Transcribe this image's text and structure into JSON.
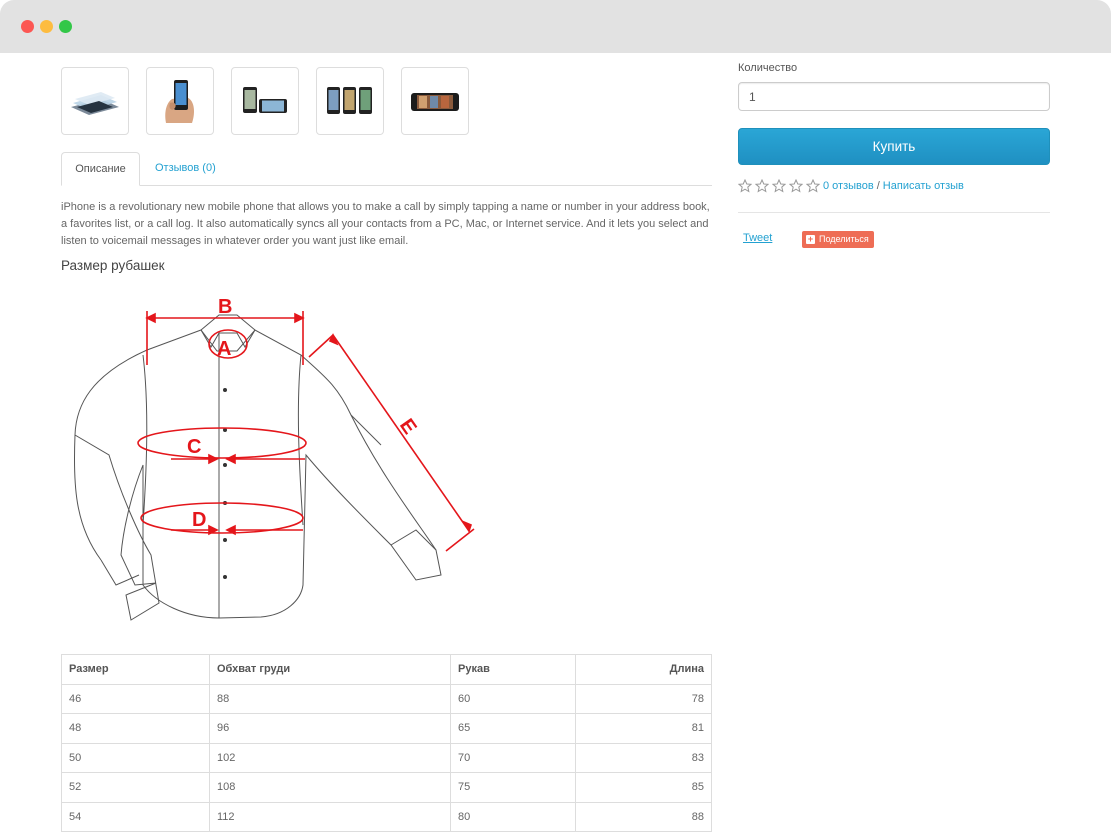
{
  "gallery": {
    "thumbnails": [
      "iphone-product-1",
      "iphone-product-2",
      "iphone-product-3",
      "iphone-product-4",
      "iphone-product-5"
    ]
  },
  "tabs": {
    "description": "Описание",
    "reviews": "Отзывов (0)"
  },
  "description": "iPhone is a revolutionary new mobile phone that allows you to make a call by simply tapping a name or number in your address book, a favorites list, or a call log. It also automatically syncs all your contacts from a PC, Mac, or Internet service. And it lets you select and listen to voicemail messages in whatever order you want just like email.",
  "size_section": {
    "title": "Размер рубашек",
    "diagram_labels": {
      "a": "A",
      "b": "B",
      "c": "C",
      "d": "D",
      "e": "E"
    }
  },
  "size_table": {
    "headers": [
      "Размер",
      "Обхват груди",
      "Рукав",
      "Длина"
    ],
    "rows": [
      [
        "46",
        "88",
        "60",
        "78"
      ],
      [
        "48",
        "96",
        "65",
        "81"
      ],
      [
        "50",
        "102",
        "70",
        "83"
      ],
      [
        "52",
        "108",
        "75",
        "85"
      ],
      [
        "54",
        "112",
        "80",
        "88"
      ]
    ]
  },
  "purchase": {
    "quantity_label": "Количество",
    "quantity_value": "1",
    "buy_label": "Купить"
  },
  "rating": {
    "stars_filled": 0,
    "stars_total": 5,
    "reviews_link": "0 отзывов",
    "separator": "/",
    "write_review_link": "Написать отзыв"
  },
  "social": {
    "tweet": "Tweet",
    "share": "Поделиться"
  },
  "colors": {
    "link": "#23a1d1",
    "buy_button": "#229ac8",
    "diagram_red": "#e4161b",
    "share_button": "#ee6d55"
  }
}
